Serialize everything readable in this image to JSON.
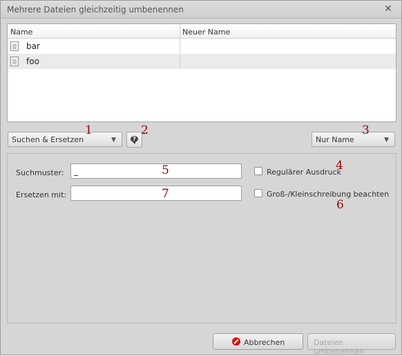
{
  "window": {
    "title": "Mehrere Dateien gleichzeitig umbenennen",
    "close_glyph": "✕"
  },
  "filelist": {
    "headers": [
      "Name",
      "Neuer Name"
    ],
    "rows": [
      {
        "name": "bar",
        "new_name": ""
      },
      {
        "name": "foo",
        "new_name": ""
      }
    ]
  },
  "mode_combo": {
    "label": "Suchen & Ersetzen",
    "arrow": "▼"
  },
  "scope_combo": {
    "label": "Nur Name",
    "arrow": "▼"
  },
  "help_button": {
    "icon": "speech-bubble-question",
    "glyph": "?"
  },
  "form": {
    "search_label": "Suchmuster:",
    "search_value": "_",
    "replace_label": "Ersetzen mit:",
    "replace_value": "",
    "regex_label": "Regulärer Ausdruck",
    "regex_checked": false,
    "case_label": "Groß-/Kleinschreibung beachten",
    "case_checked": false
  },
  "buttons": {
    "cancel": "Abbrechen",
    "rename": "Dateien umbenennen"
  },
  "annotations": [
    "1",
    "2",
    "3",
    "4",
    "5",
    "6",
    "7"
  ],
  "colors": {
    "annotation": "#9b0000",
    "cancel_icon": "#dd1111"
  }
}
